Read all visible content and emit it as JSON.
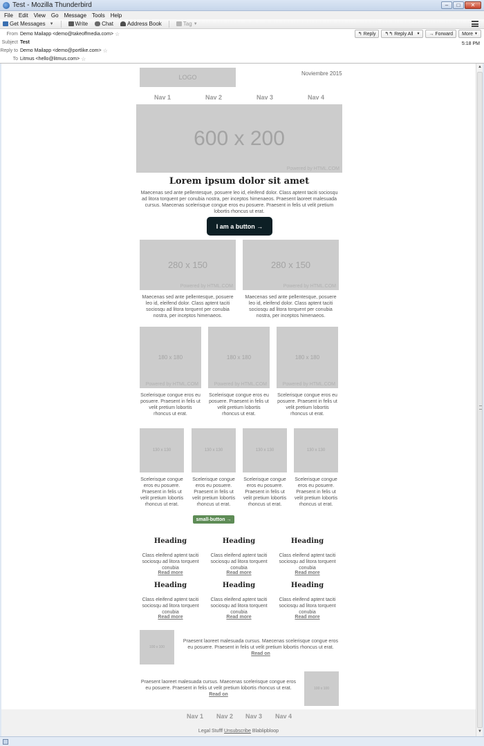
{
  "window": {
    "title": "Test - Mozilla Thunderbird",
    "minimize": "–",
    "maximize": "□",
    "close": "✕"
  },
  "menu": [
    "File",
    "Edit",
    "View",
    "Go",
    "Message",
    "Tools",
    "Help"
  ],
  "toolbar": {
    "get_messages": "Get Messages",
    "write": "Write",
    "chat": "Chat",
    "address_book": "Address Book",
    "tag": "Tag"
  },
  "message_header": {
    "labels": {
      "from": "From",
      "subject": "Subject",
      "reply_to": "Reply to",
      "to": "To"
    },
    "from": "Demo Mailapp <demo@takeoffmedia.com>",
    "subject": "Test",
    "reply_to": "Demo Mailapp <demo@portlike.com>",
    "to": "Litmus <hello@litmus.com>",
    "time": "5:18 PM",
    "buttons": {
      "reply": "Reply",
      "reply_all": "Reply All",
      "forward": "Forward",
      "more": "More"
    }
  },
  "email": {
    "logo": "LOGO",
    "date": "Noviembre 2015",
    "nav": [
      "Nav 1",
      "Nav 2",
      "Nav 3",
      "Nav 4"
    ],
    "hero": {
      "label": "600 x 200",
      "credit": "Powered by HTML.COM"
    },
    "title": "Lorem ipsum dolor sit amet",
    "intro": "Maecenas sed ante pellentesque, posuere leo id, eleifend dolor. Class aptent taciti sociosqu ad litora torquent per conubia nostra, per inceptos himenaeos. Praesent laoreet malesuada cursus. Maecenas scelerisque congue eros eu posuere. Praesent in felis ut velit pretium lobortis rhoncus ut erat.",
    "button": "I am a button →",
    "two_col": {
      "image_label": "280 x 150",
      "credit": "Powered by HTML.COM",
      "text": "Maecenas sed ante pellentesque, posuere leo id, eleifend dolor. Class aptent taciti sociosqu ad litora torquent per conubia nostra, per inceptos himenaeos."
    },
    "three_col": {
      "image_label": "180 x 180",
      "credit": "Powered by HTML.COM",
      "text": "Scelerisque congue eros eu posuere. Praesent in felis ut velit pretium lobortis rhoncus ut erat."
    },
    "four_col": {
      "image_label": "130 x 130",
      "text": "Scelerisque congue eros eu posuere. Praesent in felis ut velit pretium lobortis rhoncus ut erat."
    },
    "small_button": "small-button →",
    "features": {
      "heading": "Heading",
      "text": "Class eleifend aptent taciti sociosqu ad litora torquent conubia",
      "read_more": "Read more"
    },
    "media_rows": {
      "image_label": "100 x 100",
      "text": "Praesent laoreet malesuada cursus. Maecenas scelerisque congue eros eu posuere. Praesent in felis ut velit pretium lobortis rhoncus ut erat.",
      "read_on": "Read on"
    },
    "footer": {
      "nav": [
        "Nav 1",
        "Nav 2",
        "Nav 3",
        "Nav 4"
      ],
      "legal": "Legal Stufff",
      "unsubscribe": "Unsubscribe",
      "extra": "Blablipbloop"
    }
  }
}
